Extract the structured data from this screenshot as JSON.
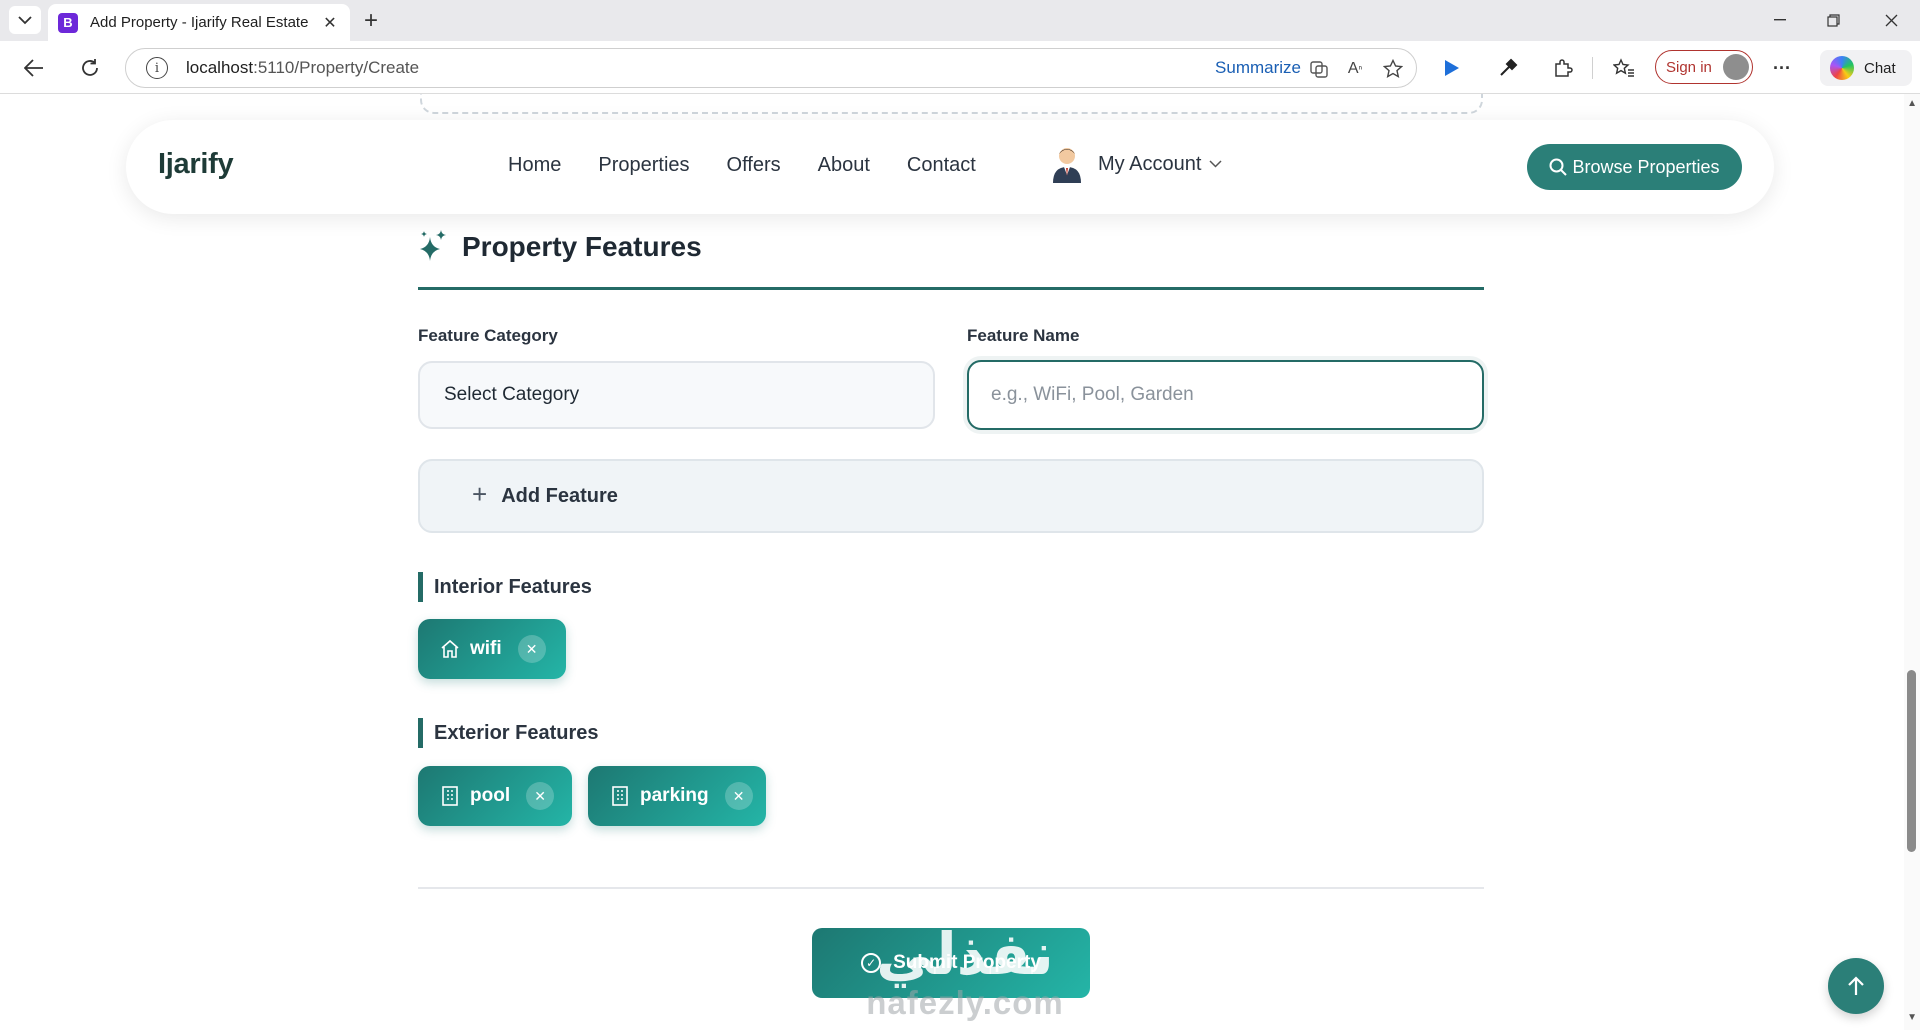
{
  "browser": {
    "tab_title": "Add Property - Ijarify Real Estate",
    "tab_favicon": "B",
    "url_host": "localhost",
    "url_path": ":5110/Property/Create",
    "summarize_label": "Summarize",
    "signin_label": "Sign in",
    "chat_label": "Chat"
  },
  "navbar": {
    "brand": "Ijarify",
    "links": [
      "Home",
      "Properties",
      "Offers",
      "About",
      "Contact"
    ],
    "account_label": "My Account",
    "browse_label": "Browse Properties"
  },
  "features": {
    "section_title": "Property Features",
    "category_label": "Feature Category",
    "category_value": "Select Category",
    "name_label": "Feature Name",
    "name_placeholder": "e.g., WiFi, Pool, Garden",
    "add_label": "Add Feature",
    "interior_title": "Interior Features",
    "interior_items": [
      "wifi"
    ],
    "exterior_title": "Exterior Features",
    "exterior_items": [
      "pool",
      "parking"
    ]
  },
  "submit_label": "Submit Property",
  "watermark": {
    "arabic": "نفذلي",
    "latin": "nafezly.com"
  },
  "colors": {
    "primary": "#246b66",
    "chip_gradient_start": "#1d7872",
    "chip_gradient_end": "#24b5a7"
  }
}
